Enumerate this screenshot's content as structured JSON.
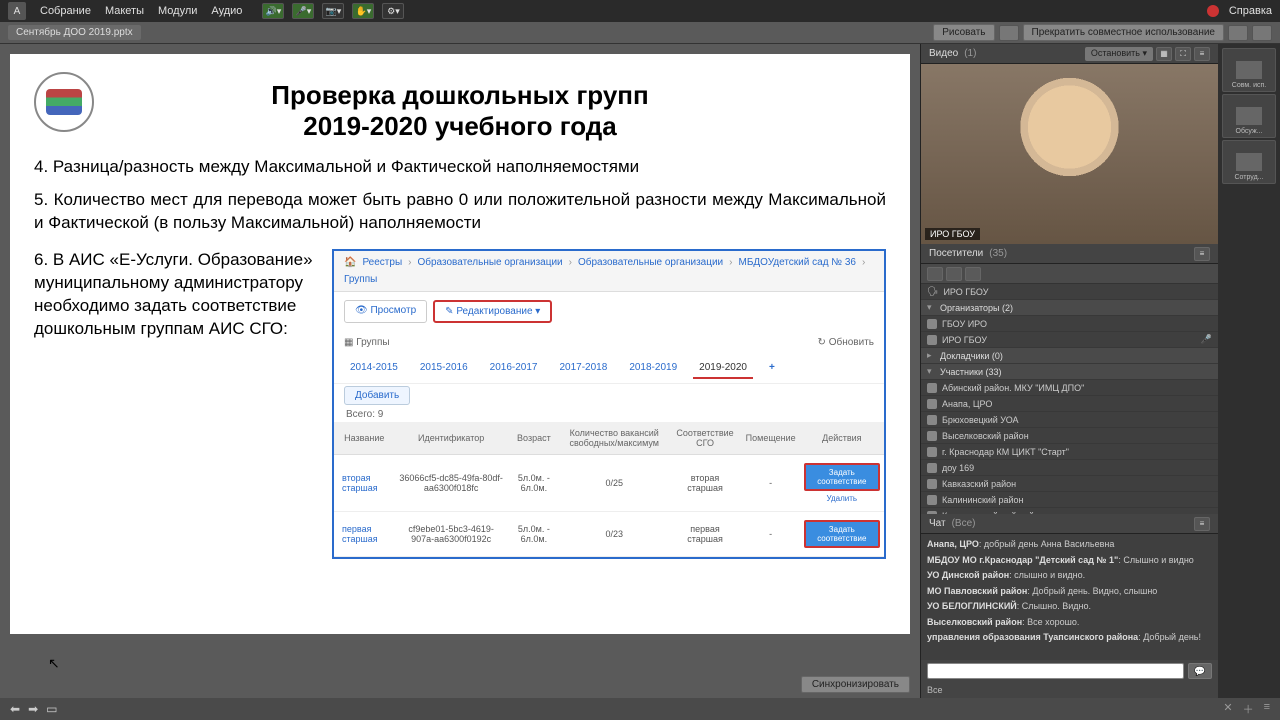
{
  "topbar": {
    "menus": [
      "Собрание",
      "Макеты",
      "Модули",
      "Аудио"
    ],
    "help": "Справка"
  },
  "filebar": {
    "filename": "Сентябрь ДОО 2019.pptx",
    "draw": "Рисовать",
    "stop_share": "Прекратить совместное использование"
  },
  "slide": {
    "title1": "Проверка дошкольных групп",
    "title2": "2019-2020 учебного года",
    "p4": "4. Разница/разность между Максимальной и Фактической наполняемостями",
    "p5": "5. Количество мест для перевода может быть равно 0 или положительной разности между Максимальной и Фактической (в пользу Максимальной) наполняемости",
    "p6": "6. В АИС «Е-Услуги. Образование» муниципальному администратору необходимо задать соответствие дошкольным группам АИС СГО:"
  },
  "eusl": {
    "bc": [
      "Реестры",
      "Образовательные организации",
      "Образовательные организации",
      "МБДОУдетский сад № 36",
      "Группы"
    ],
    "view": "Просмотр",
    "edit": "Редактирование",
    "groups": "Группы",
    "refresh": "Обновить",
    "years": [
      "2014-2015",
      "2015-2016",
      "2016-2017",
      "2017-2018",
      "2018-2019",
      "2019-2020"
    ],
    "add": "Добавить",
    "total": "Всего: 9",
    "th": [
      "Название",
      "Идентификатор",
      "Возраст",
      "Количество вакансий свободных/максимум",
      "Соответствие СГО",
      "Помещение",
      "Действия"
    ],
    "rows": [
      {
        "name": "вторая старшая",
        "id": "36066cf5-dc85-49fa-80df-aa6300f018fc",
        "age": "5л.0м. - 6л.0м.",
        "vac": "0/25",
        "sgo": "вторая старшая",
        "room": "-",
        "act": "Задать соответствие",
        "del": "Удалить"
      },
      {
        "name": "первая старшая",
        "id": "cf9ebe01-5bc3-4619-907a-aa6300f0192c",
        "age": "5л.0м. - 6л.0м.",
        "vac": "0/23",
        "sgo": "первая старшая",
        "room": "-",
        "act": "Задать соответствие",
        "del": ""
      }
    ]
  },
  "video": {
    "title": "Видео",
    "count": "(1)",
    "stop": "Остановить",
    "speaker": "ИРО ГБОУ"
  },
  "attendees": {
    "title": "Посетители",
    "count": "(35)",
    "hosts_label": "Организаторы (2)",
    "presenters_label": "Докладчики (0)",
    "participants_label": "Участники (33)",
    "current": "ИРО ГБОУ",
    "hosts": [
      "ГБОУ ИРО",
      "ИРО ГБОУ"
    ],
    "participants": [
      "Абинский район. МКУ \"ИМЦ ДПО\"",
      "Анапа, ЦРО",
      "Брюховецкий УОА",
      "Выселковский район",
      "г. Краснодар КМ ЦИКТ \"Старт\"",
      "доу 169",
      "Кавказский район",
      "Калининский район",
      "Красноармейский район"
    ]
  },
  "chat": {
    "title": "Чат",
    "scope": "(Все)",
    "messages": [
      {
        "from": "Анапа, ЦРО",
        "text": "добрый день Анна Васильевна"
      },
      {
        "from": "МБДОУ МО г.Краснодар \"Детский сад № 1\"",
        "text": "Слышно и видно"
      },
      {
        "from": "УО Динской район",
        "text": "слышно и видно."
      },
      {
        "from": "МО Павловский район",
        "text": "Добрый день. Видно, слышно"
      },
      {
        "from": "УО БЕЛОГЛИНСКИЙ",
        "text": "Слышно. Видно."
      },
      {
        "from": "Выселковский район",
        "text": "Все хорошо."
      },
      {
        "from": "управления образования Туапсинского района",
        "text": "Добрый день!"
      }
    ],
    "all": "Все"
  },
  "bottom": {
    "sync": "Синхронизировать"
  },
  "far": {
    "labels": [
      "Совм. исп.",
      "Обсуж...",
      "Сотруд..."
    ]
  }
}
